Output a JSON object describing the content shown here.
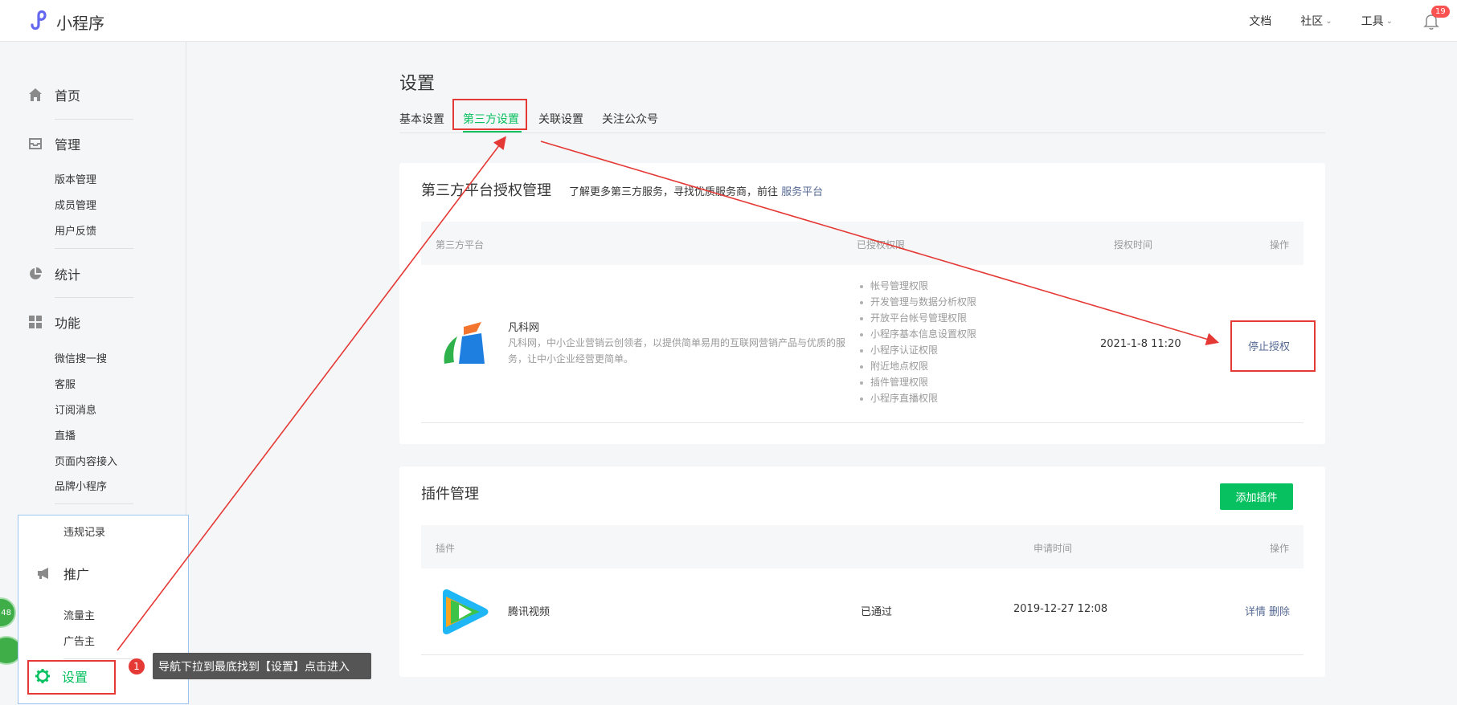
{
  "header": {
    "logo_text": "小程序",
    "links": [
      {
        "label": "文档",
        "has_chevron": false
      },
      {
        "label": "社区",
        "has_chevron": true
      },
      {
        "label": "工具",
        "has_chevron": true
      }
    ],
    "notification_count": "19"
  },
  "sidebar": {
    "home": "首页",
    "manage": "管理",
    "manage_items": [
      "版本管理",
      "成员管理",
      "用户反馈"
    ],
    "stats": "统计",
    "features": "功能",
    "feature_items": [
      "微信搜一搜",
      "客服",
      "订阅消息",
      "直播",
      "页面内容接入",
      "品牌小程序"
    ],
    "violation": "违规记录",
    "promote": "推广",
    "promote_items": [
      "流量主",
      "广告主"
    ],
    "settings": "设置",
    "floating_badge": "48"
  },
  "annotation": {
    "step": "1",
    "tip": "导航下拉到最底找到【设置】点击进入"
  },
  "page": {
    "title": "设置",
    "tabs": [
      "基本设置",
      "第三方设置",
      "关联设置",
      "关注公众号"
    ],
    "active_tab": "第三方设置"
  },
  "third_party": {
    "title": "第三方平台授权管理",
    "desc": "了解更多第三方服务，寻找优质服务商，前往",
    "desc_link": "服务平台",
    "columns": [
      "第三方平台",
      "已授权权限",
      "授权时间",
      "操作"
    ],
    "row": {
      "name": "凡科网",
      "desc": "凡科网，中小企业营销云创领者，以提供简单易用的互联网营销产品与优质的服务，让中小企业经营更简单。",
      "permissions": [
        "帐号管理权限",
        "开发管理与数据分析权限",
        "开放平台帐号管理权限",
        "小程序基本信息设置权限",
        "小程序认证权限",
        "附近地点权限",
        "插件管理权限",
        "小程序直播权限"
      ],
      "time": "2021-1-8 11:20",
      "action": "停止授权"
    }
  },
  "plugins": {
    "title": "插件管理",
    "add_button": "添加插件",
    "columns": [
      "插件",
      "申请时间",
      "操作"
    ],
    "row": {
      "name": "腾讯视频",
      "status": "已通过",
      "time": "2019-12-27 12:08",
      "actions": [
        "详情",
        "删除"
      ]
    }
  },
  "colors": {
    "accent": "#07c160",
    "link": "#576b95",
    "highlight": "#e53935"
  }
}
